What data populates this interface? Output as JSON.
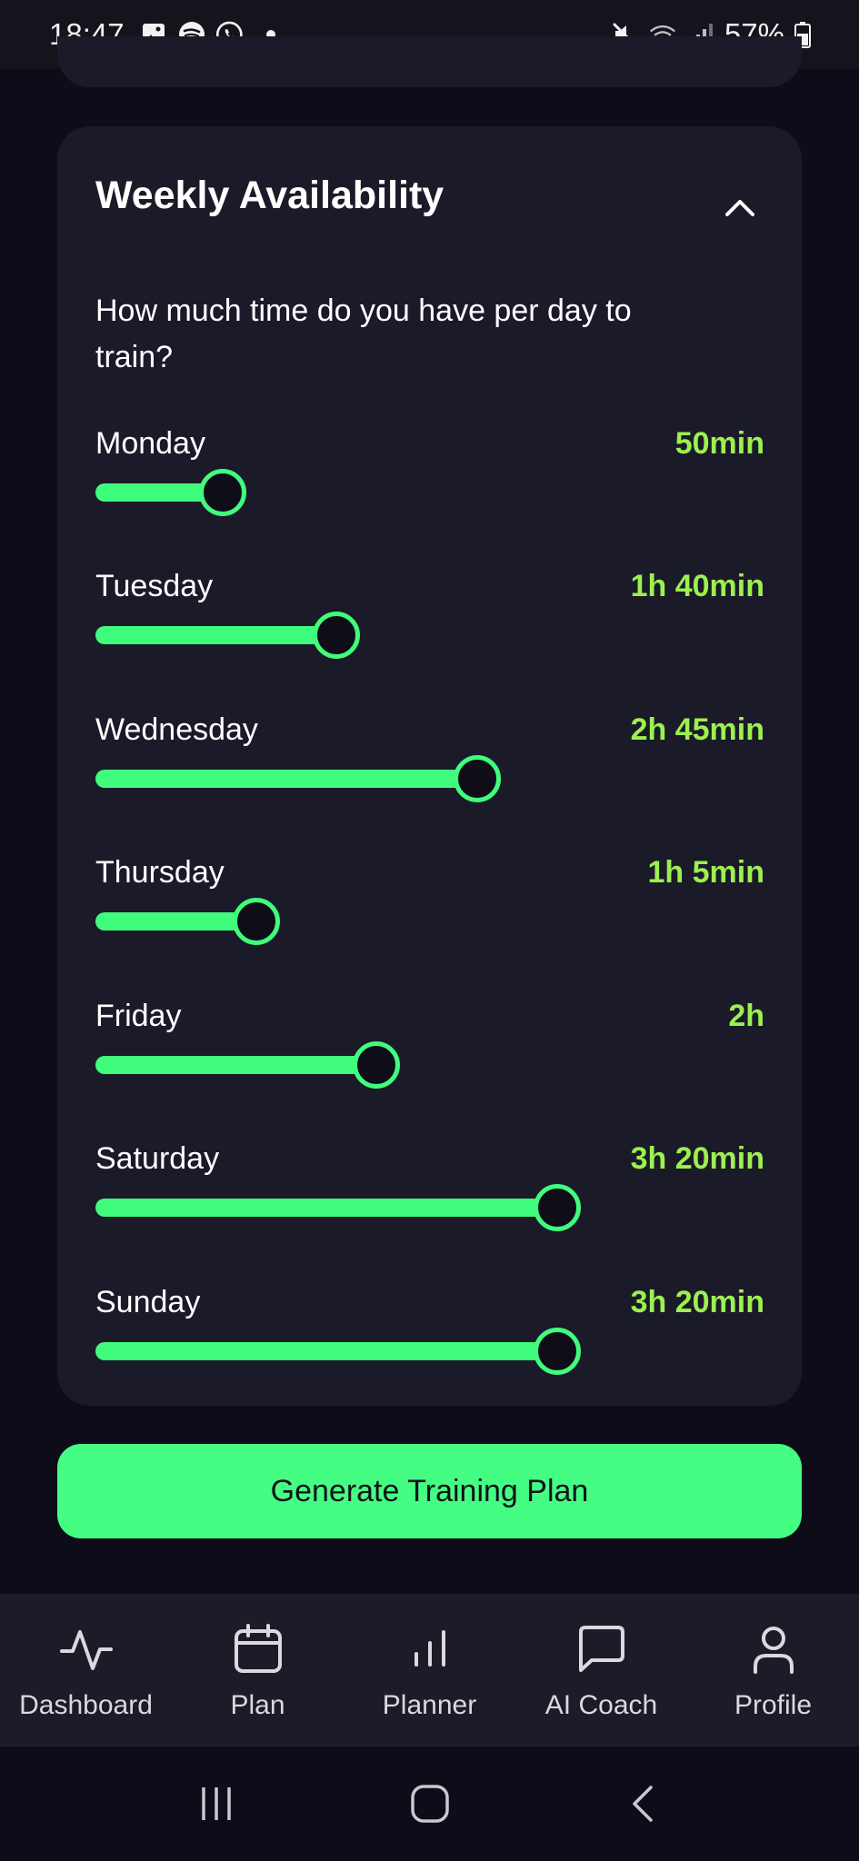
{
  "status_bar": {
    "time": "18:47",
    "battery": "57%",
    "icons": [
      "gallery-icon",
      "spotify-icon",
      "whatsapp-icon",
      "mute-icon",
      "wifi-icon",
      "signal-icon",
      "battery-icon"
    ]
  },
  "card": {
    "title": "Weekly Availability",
    "question": "How much time do you have per day to train?",
    "days": [
      {
        "label": "Monday",
        "value": "50min",
        "fraction": 0.19
      },
      {
        "label": "Tuesday",
        "value": "1h 40min",
        "fraction": 0.36
      },
      {
        "label": "Wednesday",
        "value": "2h 45min",
        "fraction": 0.57
      },
      {
        "label": "Thursday",
        "value": "1h 5min",
        "fraction": 0.24
      },
      {
        "label": "Friday",
        "value": "2h",
        "fraction": 0.42
      },
      {
        "label": "Saturday",
        "value": "3h 20min",
        "fraction": 0.69
      },
      {
        "label": "Sunday",
        "value": "3h 20min",
        "fraction": 0.69
      }
    ]
  },
  "actions": {
    "generate_label": "Generate Training Plan"
  },
  "nav": {
    "items": [
      {
        "label": "Dashboard",
        "icon": "activity-icon"
      },
      {
        "label": "Plan",
        "icon": "calendar-icon"
      },
      {
        "label": "Planner",
        "icon": "bar-chart-icon"
      },
      {
        "label": "AI Coach",
        "icon": "chat-icon"
      },
      {
        "label": "Profile",
        "icon": "user-icon"
      }
    ]
  },
  "colors": {
    "accent": "#40fc7c",
    "value_text": "#9cf04f",
    "card_bg": "#1b1a29",
    "page_bg": "#0d0c18"
  }
}
